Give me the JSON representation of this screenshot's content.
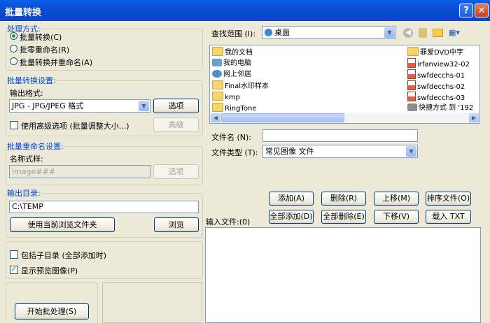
{
  "window": {
    "title": "批量转换",
    "help_label": "?",
    "close_label": "✕"
  },
  "process_mode": {
    "legend": "处理方式:",
    "options": [
      {
        "label": "批量转换(C)",
        "selected": true
      },
      {
        "label": "批零重命名(R)",
        "selected": false
      },
      {
        "label": "批量转换并重命名(A)",
        "selected": false
      }
    ]
  },
  "convert_settings": {
    "legend": "批量转换设置:",
    "format_label": "输出格式:",
    "format_value": "JPG - JPG/JPEG 格式",
    "options_button": "选项",
    "advanced_checkbox": "使用高级选项 (批量调整大小...)",
    "advanced_button": "高级"
  },
  "rename_settings": {
    "legend": "批量重命名设置:",
    "pattern_label": "名称式样:",
    "pattern_value": "image###",
    "options_button": "选项"
  },
  "output_dir": {
    "legend": "输出目录:",
    "path": "C:\\TEMP",
    "use_current_button": "使用当前浏览文件夹",
    "browse_button": "浏览"
  },
  "checks": {
    "include_subdirs": {
      "label": "包括子目录 (全部添加时)",
      "checked": false
    },
    "show_preview": {
      "label": "显示预览图像(P)",
      "checked": true
    }
  },
  "start_button": "开始批处理(S)",
  "browser": {
    "look_in_label": "查找范围 (I):",
    "look_in_value": "桌面",
    "files_left": [
      "我的文档",
      "我的电脑",
      "网上邻居",
      "Final水印样本",
      "kmp",
      "RingTone"
    ],
    "files_right": [
      "罪爱DVD中字",
      "irfanview32-02",
      "swfdecchs-01",
      "swfdecchs-02",
      "swfdecchs-03",
      "快捷方式 到 '192"
    ],
    "filename_label": "文件名 (N):",
    "filename_value": "",
    "filetype_label": "文件类型 (T):",
    "filetype_value": "常见图像 文件"
  },
  "input_buttons": {
    "add": "添加(A)",
    "remove": "删除(R)",
    "move_up": "上移(M)",
    "sort": "排序文件(O)",
    "add_all": "全部添加(D)",
    "remove_all": "全部删除(E)",
    "move_down": "下移(V)",
    "load_txt": "载入 TXT"
  },
  "input_files_label": "输入文件:(0)"
}
